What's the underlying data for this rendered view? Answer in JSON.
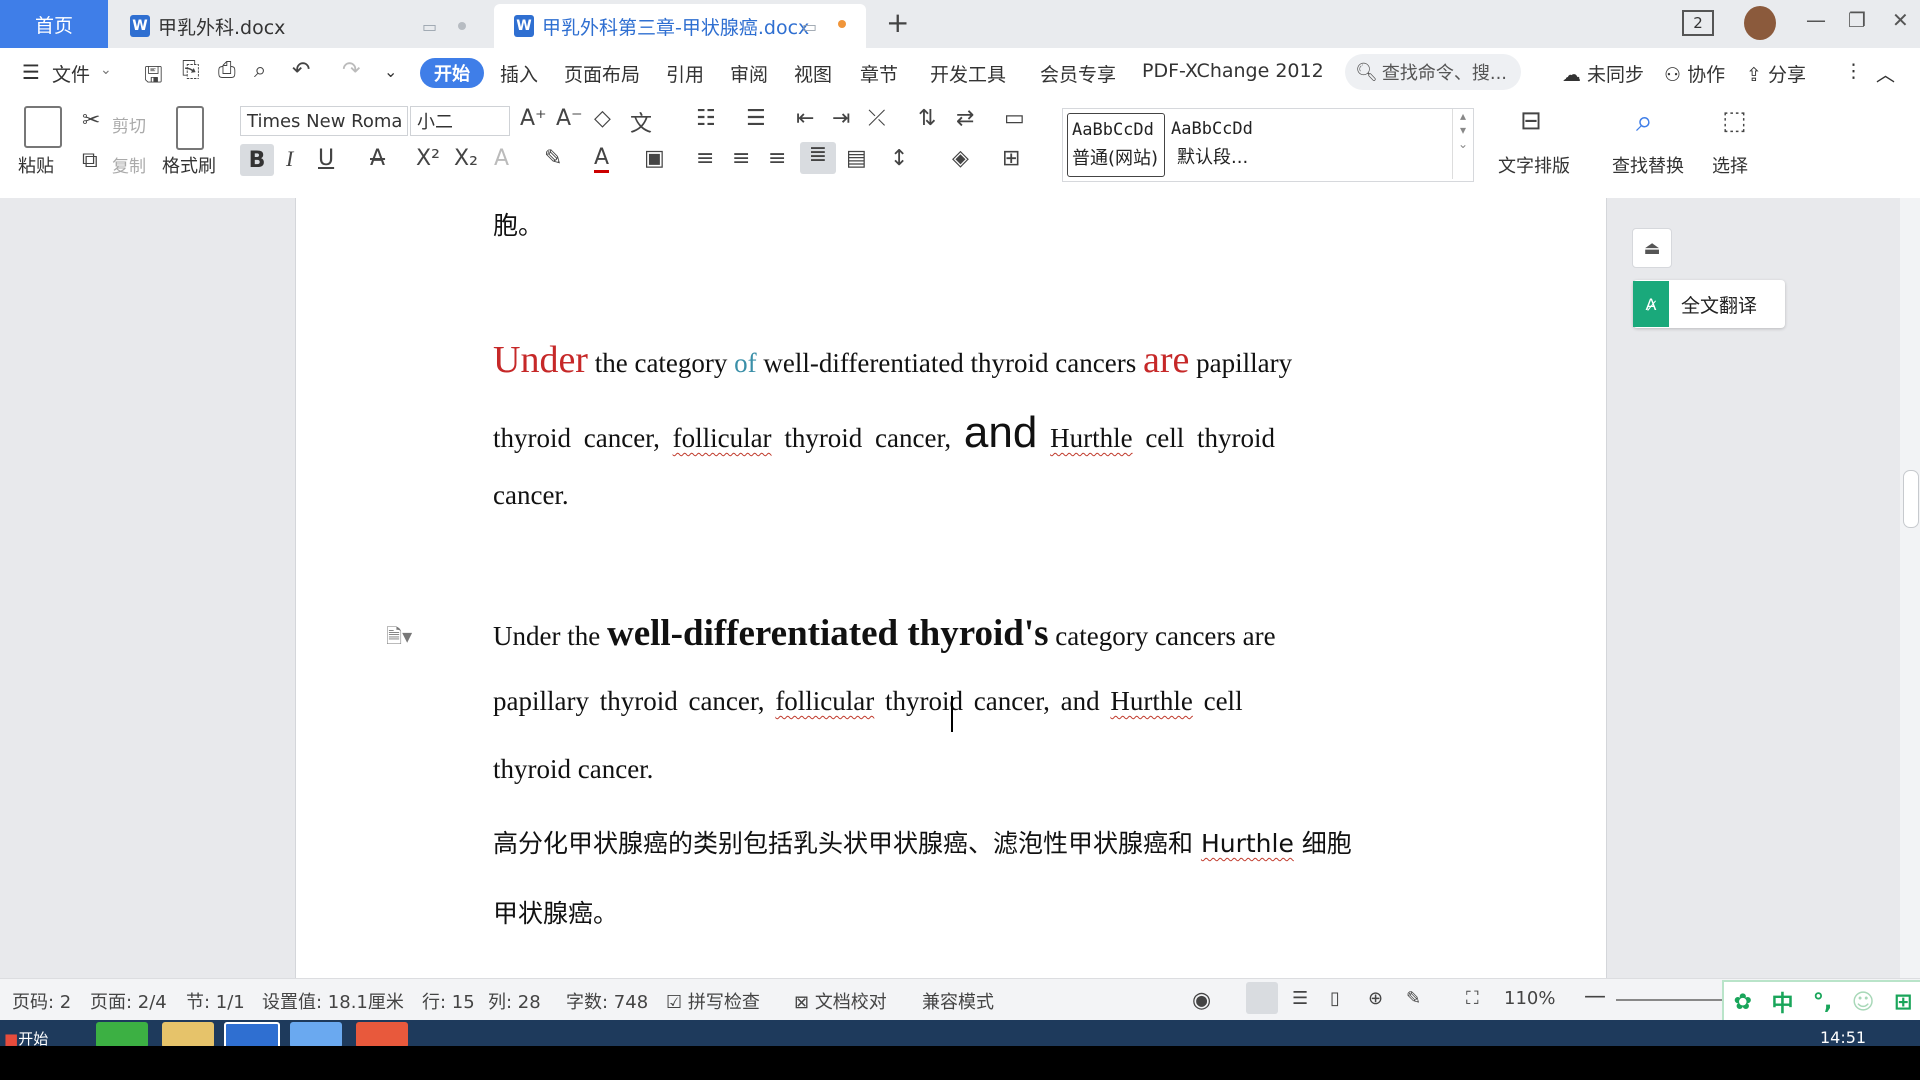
{
  "tabs": {
    "home": "首页",
    "doc1": "甲乳外科.docx",
    "doc2": "甲乳外科第三章-甲状腺癌.docx",
    "add": "+"
  },
  "window": {
    "badge": "2"
  },
  "menu": {
    "file": "文件",
    "items": [
      "开始",
      "插入",
      "页面布局",
      "引用",
      "审阅",
      "视图",
      "章节",
      "开发工具",
      "会员专享",
      "PDF-XChange 2012"
    ],
    "search_placeholder": "查找命令、搜...",
    "sync": "未同步",
    "collab": "协作",
    "share": "分享"
  },
  "ribbon": {
    "paste": "粘贴",
    "cut": "剪切",
    "copy": "复制",
    "format_painter": "格式刷",
    "font_name": "Times New Roma",
    "font_size": "小二",
    "styles": [
      {
        "preview": "AaBbCcDd",
        "name": "普通(网站)"
      },
      {
        "preview": "AaBbCcDd",
        "name": "默认段..."
      }
    ],
    "text_layout": "文字排版",
    "find_replace": "查找替换",
    "select": "选择"
  },
  "side": {
    "translate": "全文翻译"
  },
  "document": {
    "top_fragment": "胞。",
    "p1": {
      "w_under": "Under",
      "w_cat": " the category ",
      "w_of": "of",
      "w_wd": " well-differentiated thyroid cancers ",
      "w_are": "are",
      "w_pap": " papillary",
      "l2_a": "thyroid  cancer,  ",
      "l2_fol": "follicular",
      "l2_b": "  thyroid  cancer,  ",
      "l2_and": "and",
      "l2_c": "  ",
      "l2_hur": "Hurthle",
      "l2_d": "  cell  thyroid",
      "l3": "cancer."
    },
    "p2": {
      "l1_a": "Under  the  ",
      "l1_bold": "well-differentiated  thyroid's",
      "l1_b": "  category  cancers  are",
      "l2_a": "papillary  thyroid  cancer,  ",
      "l2_fol": "follicular",
      "l2_b": "  thyroid  cancer,  and  ",
      "l2_hur": "Hurthle",
      "l2_c": "  cell",
      "l3": "thyroid cancer."
    },
    "cn": {
      "l1_a": "高分化甲状腺癌的类别包括乳头状甲状腺癌、滤泡性甲状腺癌和 ",
      "l1_hur": "Hurthle",
      "l1_b": " 细胞",
      "l2": "甲状腺癌。"
    }
  },
  "status": {
    "page_code": "页码: 2",
    "pages": "页面: 2/4",
    "section": "节: 1/1",
    "setting": "设置值: 18.1厘米",
    "row": "行: 15",
    "col": "列: 28",
    "words": "字数: 748",
    "spell": "拼写检查",
    "proof": "文档校对",
    "compat": "兼容模式",
    "zoom": "110%",
    "ime_mode": "中"
  },
  "taskbar": {
    "start": "开始",
    "time": "14:51"
  },
  "colors": {
    "accent": "#3f7ee8",
    "red_word": "#c62828",
    "teal_word": "#3a8fa8",
    "translate_green": "#1aa97b"
  }
}
